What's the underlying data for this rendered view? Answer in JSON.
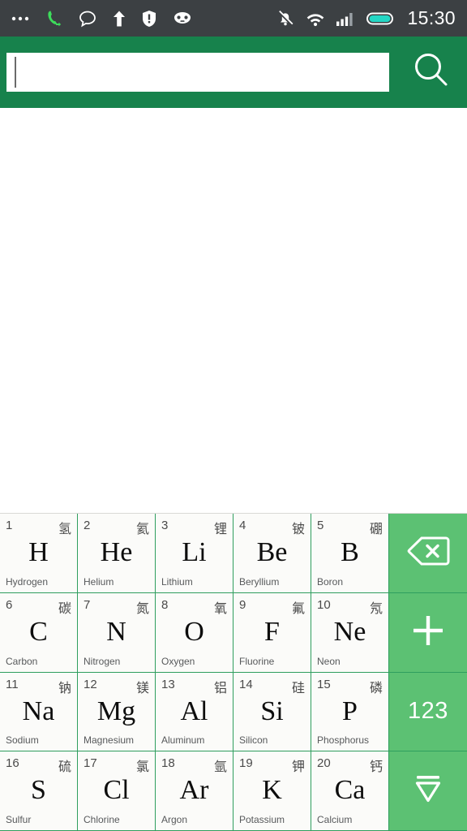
{
  "statusbar": {
    "time": "15:30",
    "left_icons": [
      {
        "name": "more-options-icon"
      },
      {
        "name": "call-forward-icon"
      },
      {
        "name": "message-icon"
      },
      {
        "name": "upload-arrow-icon"
      },
      {
        "name": "security-alert-icon"
      },
      {
        "name": "android-robot-icon"
      }
    ],
    "right_icons": [
      {
        "name": "mute-bell-icon"
      },
      {
        "name": "wifi-icon"
      },
      {
        "name": "signal-bars-icon"
      },
      {
        "name": "battery-icon"
      }
    ],
    "colors": {
      "background": "#3c4043",
      "foreground": "#ffffff",
      "call_icon": "#3ddc5b",
      "battery_fill": "#24d6c4"
    }
  },
  "search": {
    "value": "",
    "placeholder": "",
    "icon": "search-icon",
    "colors": {
      "header_background": "#17824c",
      "field_background": "#ffffff"
    }
  },
  "content": {
    "text": ""
  },
  "keyboard": {
    "colors": {
      "key_background": "#fbfbf9",
      "key_border": "#2f9e5e",
      "function_key_background": "#5cc173",
      "function_key_foreground": "#ffffff"
    },
    "rows": [
      {
        "elements": [
          {
            "number": "1",
            "cn": "氢",
            "symbol": "H",
            "name": "Hydrogen"
          },
          {
            "number": "2",
            "cn": "氦",
            "symbol": "He",
            "name": "Helium"
          },
          {
            "number": "3",
            "cn": "锂",
            "symbol": "Li",
            "name": "Lithium"
          },
          {
            "number": "4",
            "cn": "铍",
            "symbol": "Be",
            "name": "Beryllium"
          },
          {
            "number": "5",
            "cn": "硼",
            "symbol": "B",
            "name": "Boron"
          }
        ],
        "function_key": {
          "name": "backspace-key",
          "icon": "backspace-icon",
          "label": ""
        }
      },
      {
        "elements": [
          {
            "number": "6",
            "cn": "碳",
            "symbol": "C",
            "name": "Carbon"
          },
          {
            "number": "7",
            "cn": "氮",
            "symbol": "N",
            "name": "Nitrogen"
          },
          {
            "number": "8",
            "cn": "氧",
            "symbol": "O",
            "name": "Oxygen"
          },
          {
            "number": "9",
            "cn": "氟",
            "symbol": "F",
            "name": "Fluorine"
          },
          {
            "number": "10",
            "cn": "氖",
            "symbol": "Ne",
            "name": "Neon"
          }
        ],
        "function_key": {
          "name": "plus-key",
          "icon": "plus-icon",
          "label": ""
        }
      },
      {
        "elements": [
          {
            "number": "11",
            "cn": "钠",
            "symbol": "Na",
            "name": "Sodium"
          },
          {
            "number": "12",
            "cn": "镁",
            "symbol": "Mg",
            "name": "Magnesium"
          },
          {
            "number": "13",
            "cn": "铝",
            "symbol": "Al",
            "name": "Aluminum"
          },
          {
            "number": "14",
            "cn": "硅",
            "symbol": "Si",
            "name": "Silicon"
          },
          {
            "number": "15",
            "cn": "磷",
            "symbol": "P",
            "name": "Phosphorus"
          }
        ],
        "function_key": {
          "name": "numbers-key",
          "icon": "",
          "label": "123"
        }
      },
      {
        "elements": [
          {
            "number": "16",
            "cn": "硫",
            "symbol": "S",
            "name": "Sulfur"
          },
          {
            "number": "17",
            "cn": "氯",
            "symbol": "Cl",
            "name": "Chlorine"
          },
          {
            "number": "18",
            "cn": "氩",
            "symbol": "Ar",
            "name": "Argon"
          },
          {
            "number": "19",
            "cn": "钾",
            "symbol": "K",
            "name": "Potassium"
          },
          {
            "number": "20",
            "cn": "钙",
            "symbol": "Ca",
            "name": "Calcium"
          }
        ],
        "function_key": {
          "name": "hide-keyboard-key",
          "icon": "hide-keyboard-icon",
          "label": ""
        }
      }
    ]
  }
}
